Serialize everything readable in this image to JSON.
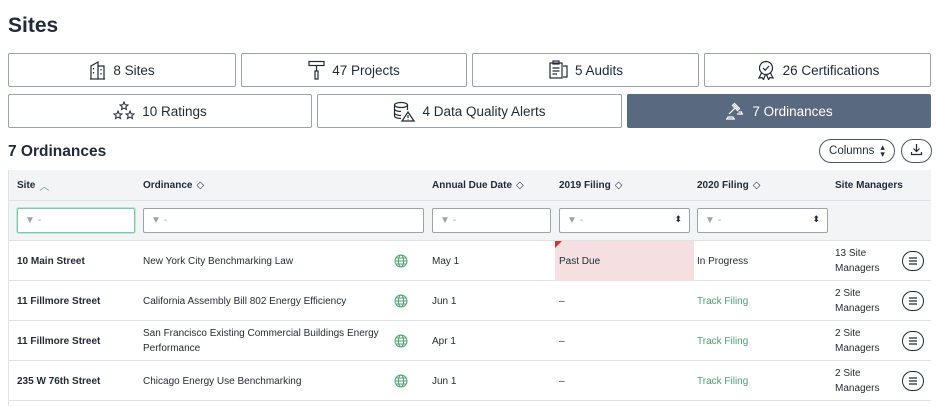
{
  "page": {
    "title": "Sites"
  },
  "tabs": [
    {
      "label": "8 Sites",
      "icon": "building-icon"
    },
    {
      "label": "47 Projects",
      "icon": "paint-roller-icon"
    },
    {
      "label": "5 Audits",
      "icon": "clipboard-icon"
    },
    {
      "label": "26 Certifications",
      "icon": "award-icon"
    },
    {
      "label": "10 Ratings",
      "icon": "stars-icon"
    },
    {
      "label": "4 Data Quality Alerts",
      "icon": "database-alert-icon"
    },
    {
      "label": "7 Ordinances",
      "icon": "gavel-icon",
      "active": true
    }
  ],
  "section": {
    "title": "7 Ordinances"
  },
  "toolbar": {
    "columns_label": "Columns",
    "download_icon": "download-icon"
  },
  "table": {
    "columns": [
      "Site",
      "Ordinance",
      "Annual Due Date",
      "2019 Filing",
      "2020 Filing",
      "Site Managers"
    ],
    "filter_placeholder": "-",
    "rows": [
      {
        "site": "10 Main Street",
        "ordinance": "New York City Benchmarking Law",
        "due": "May 1",
        "f2019": "Past Due",
        "f2020": "In Progress",
        "managers": "13 Site Managers"
      },
      {
        "site": "11 Fillmore Street",
        "ordinance": "California Assembly Bill 802 Energy Efficiency",
        "due": "Jun 1",
        "f2019": "–",
        "f2020": "Track Filing",
        "managers": "2 Site Managers"
      },
      {
        "site": "11 Fillmore Street",
        "ordinance": "San Francisco Existing Commercial Buildings Energy Performance",
        "due": "Apr 1",
        "f2019": "–",
        "f2020": "Track Filing",
        "managers": "2 Site Managers"
      },
      {
        "site": "235 W 76th Street",
        "ordinance": "Chicago Energy Use Benchmarking",
        "due": "Jun 1",
        "f2019": "–",
        "f2020": "Track Filing",
        "managers": "2 Site Managers"
      }
    ]
  },
  "colors": {
    "active_tab": "#596a80",
    "accent_green": "#4aa36f",
    "past_due_bg": "#f6dfe0",
    "flag_red": "#d0322e"
  }
}
